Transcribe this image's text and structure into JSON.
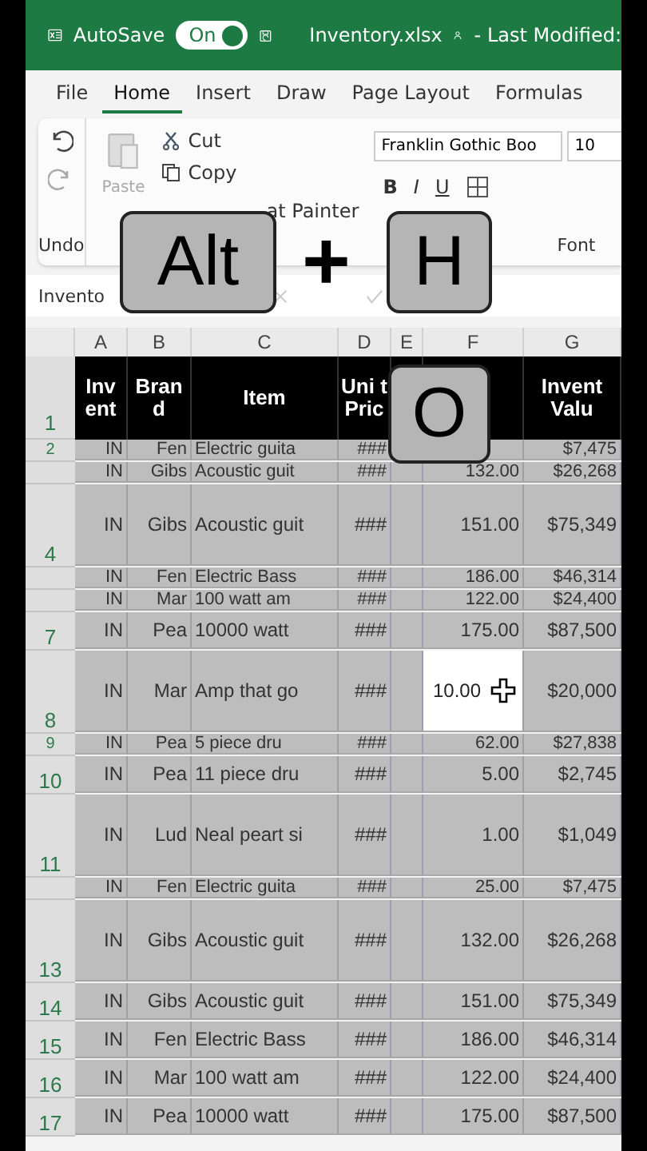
{
  "title_bar": {
    "autosave_label": "AutoSave",
    "autosave": {
      "label": "On",
      "on": true
    },
    "filename": "Inventory.xlsx",
    "modified": "- Last Modified:"
  },
  "tabs": [
    {
      "label": "File",
      "selected": false
    },
    {
      "label": "Home",
      "selected": true
    },
    {
      "label": "Insert",
      "selected": false
    },
    {
      "label": "Draw",
      "selected": false
    },
    {
      "label": "Page Layout",
      "selected": false
    },
    {
      "label": "Formulas",
      "selected": false
    }
  ],
  "ribbon": {
    "undo_group": "Undo",
    "paste": {
      "label": "Paste",
      "disabled": true
    },
    "cut": "Cut",
    "copy": "Copy",
    "format_painter": "at Painter",
    "font_name": "Franklin Gothic Boo",
    "font_size": "10",
    "font_buttons": [
      "B",
      "I",
      "U"
    ],
    "font_group": "Font"
  },
  "formula_bar": {
    "name_box": "Invento"
  },
  "grid": {
    "columns": [
      "A",
      "B",
      "C",
      "D",
      "E",
      "F",
      "G"
    ],
    "header_row": {
      "number": "1",
      "a": "Inv ent",
      "b": "Bran d",
      "c": "Item",
      "d": "Uni t Pric",
      "g": "Invent Valu"
    },
    "rows": [
      {
        "number": "2",
        "kind": "short",
        "selected": false,
        "a": "IN",
        "b": "Fen",
        "c": "Electric guita",
        "d": "###",
        "g": "$7,475"
      },
      {
        "kind": "short",
        "selected": false,
        "a": "IN",
        "b": "Gibs",
        "c": "Acoustic guit",
        "d": "###",
        "f": "132.00",
        "g": "$26,268"
      },
      {
        "number": "4",
        "kind": "tall",
        "selected": false,
        "a": "IN",
        "b": "Gibs",
        "c": "Acoustic guit",
        "d": "###",
        "f": "151.00",
        "g": "$75,349"
      },
      {
        "kind": "short",
        "selected": false,
        "a": "IN",
        "b": "Fen",
        "c": "Electric Bass",
        "d": "###",
        "f": "186.00",
        "g": "$46,314"
      },
      {
        "kind": "short",
        "selected": false,
        "a": "IN",
        "b": "Mar",
        "c": "100 watt am",
        "d": "###",
        "f": "122.00",
        "g": "$24,400"
      },
      {
        "number": "7",
        "kind": "normal",
        "selected": false,
        "a": "IN",
        "b": "Pea",
        "c": "10000 watt",
        "d": "###",
        "f": "175.00",
        "g": "$87,500"
      },
      {
        "number": "8",
        "kind": "tall",
        "selected": true,
        "a": "IN",
        "b": "Mar",
        "c": "Amp that go",
        "d": "###",
        "f": "10.00",
        "g": "$20,000"
      },
      {
        "number": "9",
        "kind": "short",
        "selected": false,
        "a": "IN",
        "b": "Pea",
        "c": "5 piece dru",
        "d": "###",
        "f": "62.00",
        "g": "$27,838"
      },
      {
        "number": "10",
        "kind": "normal",
        "selected": false,
        "a": "IN",
        "b": "Pea",
        "c": "11 piece dru",
        "d": "###",
        "f": "5.00",
        "g": "$2,745"
      },
      {
        "number": "11",
        "kind": "tall",
        "selected": false,
        "a": "IN",
        "b": "Lud",
        "c": "Neal peart si",
        "d": "###",
        "f": "1.00",
        "g": "$1,049"
      },
      {
        "kind": "short",
        "selected": false,
        "a": "IN",
        "b": "Fen",
        "c": "Electric guita",
        "d": "###",
        "f": "25.00",
        "g": "$7,475"
      },
      {
        "number": "13",
        "kind": "tall",
        "selected": false,
        "a": "IN",
        "b": "Gibs",
        "c": "Acoustic guit",
        "d": "###",
        "f": "132.00",
        "g": "$26,268"
      },
      {
        "number": "14",
        "kind": "normal",
        "selected": false,
        "a": "IN",
        "b": "Gibs",
        "c": "Acoustic guit",
        "d": "###",
        "f": "151.00",
        "g": "$75,349"
      },
      {
        "number": "15",
        "kind": "normal",
        "selected": false,
        "a": "IN",
        "b": "Fen",
        "c": "Electric Bass",
        "d": "###",
        "f": "186.00",
        "g": "$46,314"
      },
      {
        "number": "16",
        "kind": "normal",
        "selected": false,
        "a": "IN",
        "b": "Mar",
        "c": "100 watt am",
        "d": "###",
        "f": "122.00",
        "g": "$24,400"
      },
      {
        "number": "17",
        "kind": "normal",
        "selected": false,
        "a": "IN",
        "b": "Pea",
        "c": "10000 watt",
        "d": "###",
        "f": "175.00",
        "g": "$87,500"
      }
    ]
  },
  "overlay_keys": [
    {
      "kind": "key",
      "label": "Alt"
    },
    {
      "kind": "plus",
      "label": "+"
    },
    {
      "kind": "key",
      "label": "H"
    },
    {
      "kind": "key",
      "label": "O"
    }
  ]
}
